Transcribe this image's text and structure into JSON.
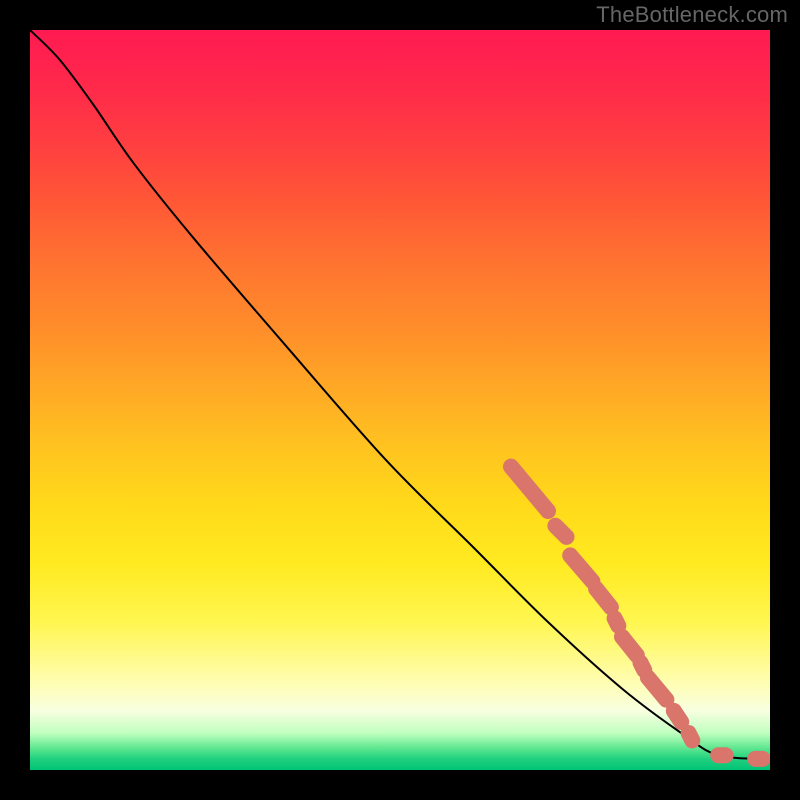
{
  "watermark": "TheBottleneck.com",
  "chart_data": {
    "type": "line",
    "title": "",
    "xlabel": "",
    "ylabel": "",
    "xlim": [
      0,
      100
    ],
    "ylim": [
      0,
      100
    ],
    "background_zones_note": "vertical gradient from red (top/high y) through orange, yellow, pale, to green (bottom/low y)",
    "curve_note": "monotone descending curve from top-left to bottom-right; steep near top, slight flattening near bottom right",
    "curve_points": [
      {
        "x_pct": 0.0,
        "y_pct": 100.0
      },
      {
        "x_pct": 4.0,
        "y_pct": 96.0
      },
      {
        "x_pct": 8.5,
        "y_pct": 90.0
      },
      {
        "x_pct": 14.0,
        "y_pct": 82.0
      },
      {
        "x_pct": 22.0,
        "y_pct": 72.0
      },
      {
        "x_pct": 34.0,
        "y_pct": 58.0
      },
      {
        "x_pct": 48.0,
        "y_pct": 42.0
      },
      {
        "x_pct": 60.0,
        "y_pct": 30.0
      },
      {
        "x_pct": 70.0,
        "y_pct": 20.0
      },
      {
        "x_pct": 80.0,
        "y_pct": 11.0
      },
      {
        "x_pct": 88.0,
        "y_pct": 5.0
      },
      {
        "x_pct": 93.0,
        "y_pct": 2.0
      },
      {
        "x_pct": 100.0,
        "y_pct": 1.5
      }
    ],
    "highlight_segments_note": "pink rounded capsule markers overlaid along the lower-right portion of the curve",
    "highlight_segments": [
      {
        "x1_pct": 65.0,
        "y1_pct": 41.0,
        "x2_pct": 70.0,
        "y2_pct": 35.0
      },
      {
        "x1_pct": 71.0,
        "y1_pct": 33.0,
        "x2_pct": 72.5,
        "y2_pct": 31.5
      },
      {
        "x1_pct": 73.0,
        "y1_pct": 29.0,
        "x2_pct": 76.0,
        "y2_pct": 25.5
      },
      {
        "x1_pct": 76.5,
        "y1_pct": 24.5,
        "x2_pct": 78.5,
        "y2_pct": 22.0
      },
      {
        "x1_pct": 79.0,
        "y1_pct": 20.5,
        "x2_pct": 79.5,
        "y2_pct": 19.5
      },
      {
        "x1_pct": 80.0,
        "y1_pct": 18.0,
        "x2_pct": 82.0,
        "y2_pct": 15.5
      },
      {
        "x1_pct": 82.5,
        "y1_pct": 14.5,
        "x2_pct": 83.0,
        "y2_pct": 13.5
      },
      {
        "x1_pct": 83.5,
        "y1_pct": 12.5,
        "x2_pct": 86.0,
        "y2_pct": 9.5
      },
      {
        "x1_pct": 87.0,
        "y1_pct": 8.0,
        "x2_pct": 88.0,
        "y2_pct": 6.5
      },
      {
        "x1_pct": 89.0,
        "y1_pct": 5.0,
        "x2_pct": 89.5,
        "y2_pct": 4.0
      },
      {
        "x1_pct": 93.0,
        "y1_pct": 2.0,
        "x2_pct": 94.0,
        "y2_pct": 2.0
      },
      {
        "x1_pct": 98.0,
        "y1_pct": 1.5,
        "x2_pct": 99.0,
        "y2_pct": 1.5
      }
    ]
  }
}
